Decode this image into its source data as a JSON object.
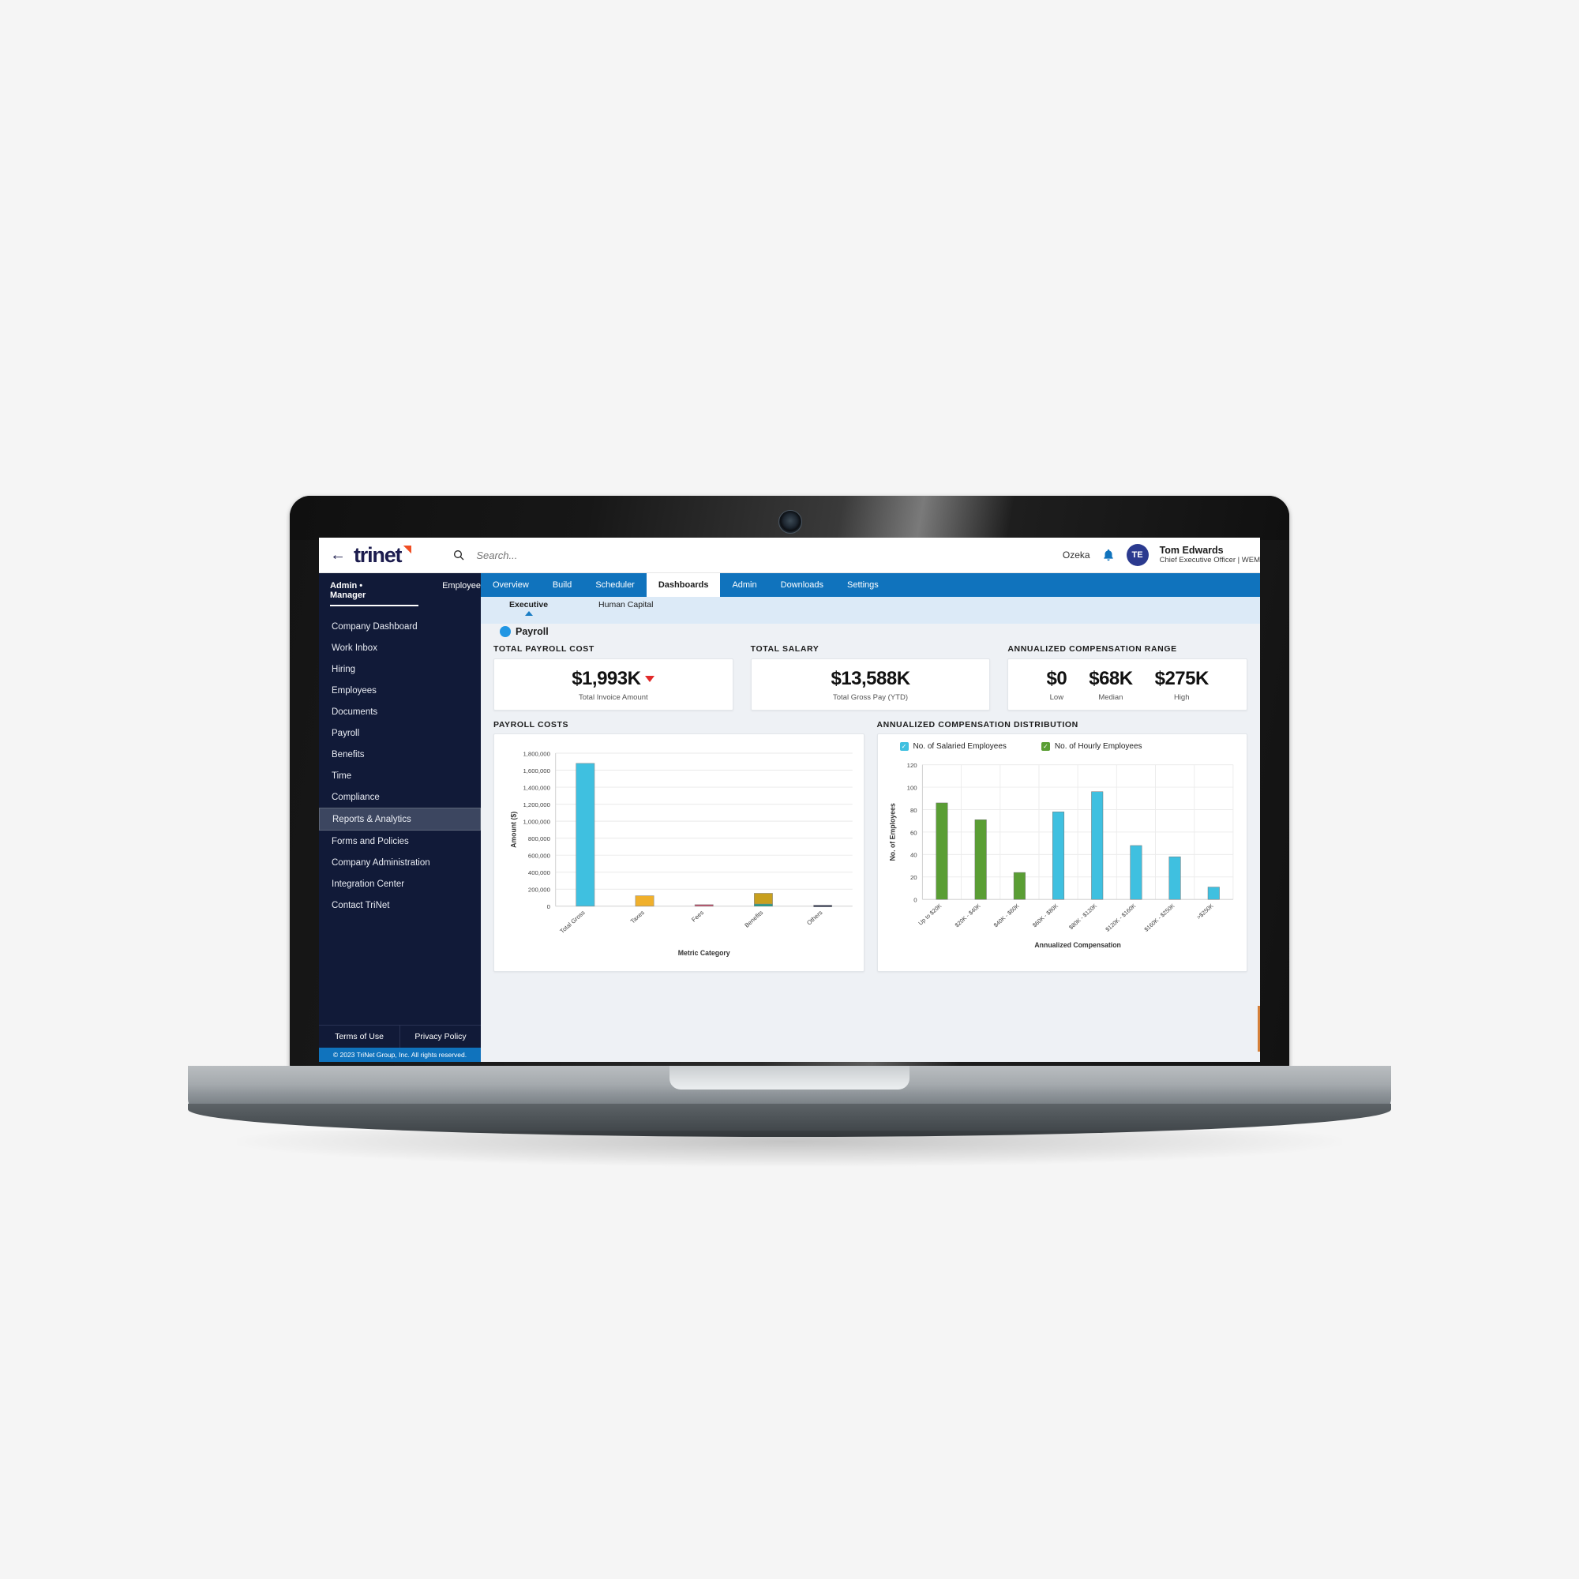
{
  "app": {
    "brand": "trinet",
    "back_icon": "back-arrow-icon",
    "search_placeholder": "Search...",
    "search_value": "",
    "org_name": "Ozeka",
    "notification_icon": "bell-icon",
    "user": {
      "initials": "TE",
      "name": "Tom Edwards",
      "role": "Chief Executive Officer | WEM"
    }
  },
  "sidebar": {
    "role_tabs": [
      {
        "label": "Admin • Manager",
        "active": true
      },
      {
        "label": "Employee",
        "active": false
      }
    ],
    "items": [
      {
        "label": "Company Dashboard",
        "active": false
      },
      {
        "label": "Work Inbox",
        "active": false
      },
      {
        "label": "Hiring",
        "active": false
      },
      {
        "label": "Employees",
        "active": false
      },
      {
        "label": "Documents",
        "active": false
      },
      {
        "label": "Payroll",
        "active": false
      },
      {
        "label": "Benefits",
        "active": false
      },
      {
        "label": "Time",
        "active": false
      },
      {
        "label": "Compliance",
        "active": false
      },
      {
        "label": "Reports & Analytics",
        "active": true
      },
      {
        "label": "Forms and Policies",
        "active": false
      },
      {
        "label": "Company Administration",
        "active": false
      },
      {
        "label": "Integration Center",
        "active": false
      },
      {
        "label": "Contact TriNet",
        "active": false
      }
    ],
    "footer_links": [
      {
        "label": "Terms of Use"
      },
      {
        "label": "Privacy Policy"
      }
    ],
    "copyright": "© 2023 TriNet Group, Inc. All rights reserved."
  },
  "nav": {
    "tabs": [
      {
        "label": "Overview",
        "active": false
      },
      {
        "label": "Build",
        "active": false
      },
      {
        "label": "Scheduler",
        "active": false
      },
      {
        "label": "Dashboards",
        "active": true
      },
      {
        "label": "Admin",
        "active": false
      },
      {
        "label": "Downloads",
        "active": false
      },
      {
        "label": "Settings",
        "active": false
      }
    ],
    "subtabs": [
      {
        "label": "Executive",
        "active": true
      },
      {
        "label": "Human Capital",
        "active": false
      }
    ]
  },
  "section": {
    "title": "Payroll"
  },
  "kpis": [
    {
      "label": "TOTAL PAYROLL COST",
      "value": "$1,993K",
      "caption": "Total Invoice Amount",
      "trend": "down",
      "trend_color": "#e12a2a"
    },
    {
      "label": "TOTAL SALARY",
      "value": "$13,588K",
      "caption": "Total Gross Pay (YTD)",
      "trend": "none"
    },
    {
      "label": "ANNUALIZED COMPENSATION RANGE",
      "values": [
        {
          "value": "$0",
          "caption": "Low"
        },
        {
          "value": "$68K",
          "caption": "Median"
        },
        {
          "value": "$275K",
          "caption": "High"
        }
      ]
    }
  ],
  "chart_data": [
    {
      "type": "bar",
      "title": "PAYROLL COSTS",
      "xlabel": "Metric Category",
      "ylabel": "Amount ($)",
      "categories": [
        "Total Gross",
        "Taxes",
        "Fees",
        "Benefits",
        "Others"
      ],
      "values": [
        1680000,
        123000,
        18000,
        152000,
        11000
      ],
      "colors": [
        "#3fc0e0",
        "#f0b02c",
        "#c24463",
        "#c8a01e",
        "#1b2340"
      ],
      "stacked_segments": [
        {
          "category": "Benefits",
          "segments": [
            {
              "value": 26000,
              "color": "#179a86"
            },
            {
              "value": 126000,
              "color": "#c8a01e"
            }
          ]
        }
      ],
      "ylim": [
        0,
        1800000
      ],
      "yticks": [
        0,
        200000,
        400000,
        600000,
        800000,
        1000000,
        1200000,
        1400000,
        1600000,
        1800000
      ],
      "ytick_labels": [
        "0",
        "200,000",
        "400,000",
        "600,000",
        "800,000",
        "1,000,000",
        "1,200,000",
        "1,400,000",
        "1,600,000",
        "1,800,000"
      ],
      "grid": true,
      "legend": "none"
    },
    {
      "type": "bar",
      "title": "ANNUALIZED COMPENSATION DISTRIBUTION",
      "xlabel": "Annualized Compensation",
      "ylabel": "No. of Employees",
      "categories": [
        "Up to $20K",
        "$20K - $40K",
        "$40K - $60K",
        "$60K - $80K",
        "$80K - $120K",
        "$120K - $160K",
        "$160K - $250K",
        ">$250K"
      ],
      "series": [
        {
          "name": "No. of Salaried Employees",
          "color": "#3fc0e0",
          "values": [
            0,
            0,
            0,
            78,
            96,
            48,
            38,
            11
          ]
        },
        {
          "name": "No. of Hourly Employees",
          "color": "#5a9e34",
          "values": [
            86,
            71,
            24,
            0,
            0,
            0,
            0,
            0
          ]
        }
      ],
      "ylim": [
        0,
        120
      ],
      "yticks": [
        0,
        20,
        40,
        60,
        80,
        100,
        120
      ],
      "ytick_labels": [
        "0",
        "20",
        "40",
        "60",
        "80",
        "100",
        "120"
      ],
      "grid": true,
      "legend": "top-left"
    }
  ],
  "colors": {
    "brand_blue": "#1073bd",
    "sidebar_navy": "#111a38",
    "accent_orange": "#f04e23",
    "salaried": "#3fc0e0",
    "hourly": "#5a9e34"
  }
}
